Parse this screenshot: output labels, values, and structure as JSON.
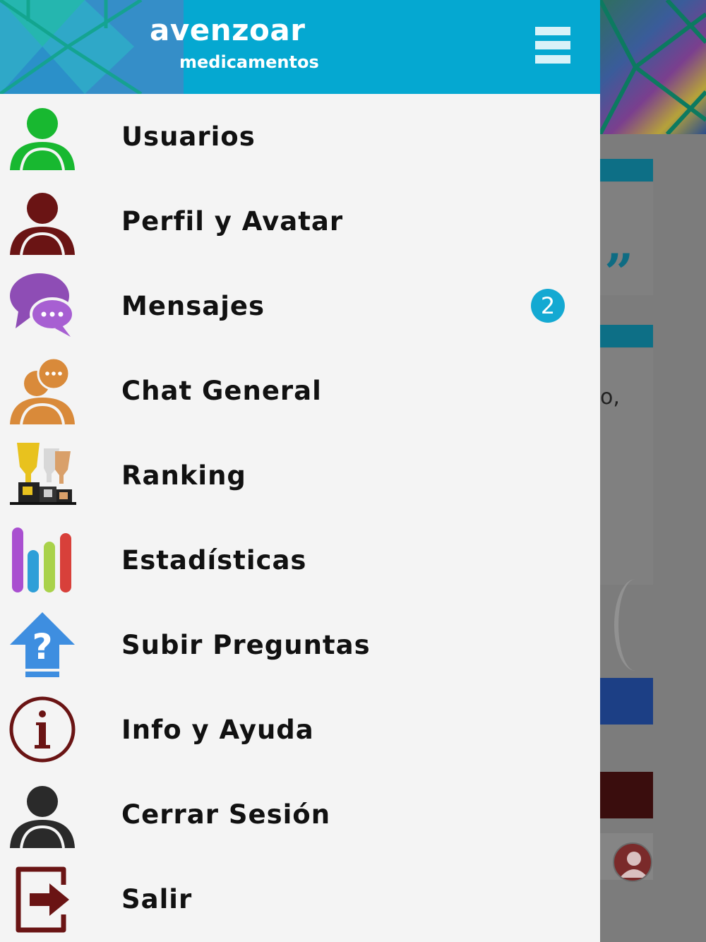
{
  "app": {
    "logo_main": "avenzoar",
    "logo_sub": "medicamentos",
    "header_color": "#05a8d1"
  },
  "menu": {
    "items": [
      {
        "label": "Usuarios",
        "icon": "user-green-icon",
        "color": "#18b830"
      },
      {
        "label": "Perfil y Avatar",
        "icon": "user-darkred-icon",
        "color": "#6a1414"
      },
      {
        "label": "Mensajes",
        "icon": "chat-bubbles-icon",
        "color": "#8e4db5",
        "badge": "2"
      },
      {
        "label": "Chat General",
        "icon": "user-chat-icon",
        "color": "#d98a3a"
      },
      {
        "label": "Ranking",
        "icon": "trophy-podium-icon",
        "color": "#d9b420"
      },
      {
        "label": "Estadísticas",
        "icon": "bar-stats-icon",
        "color": "#a94fd0"
      },
      {
        "label": "Subir Preguntas",
        "icon": "upload-question-icon",
        "color": "#3e8ee0"
      },
      {
        "label": "Info y Ayuda",
        "icon": "info-icon",
        "color": "#6a1414"
      },
      {
        "label": "Cerrar Sesión",
        "icon": "user-dark-icon",
        "color": "#2a2a2a"
      },
      {
        "label": "Salir",
        "icon": "exit-icon",
        "color": "#6a1414"
      }
    ]
  },
  "background": {
    "quote_mark": "”",
    "fragment": "o,"
  }
}
